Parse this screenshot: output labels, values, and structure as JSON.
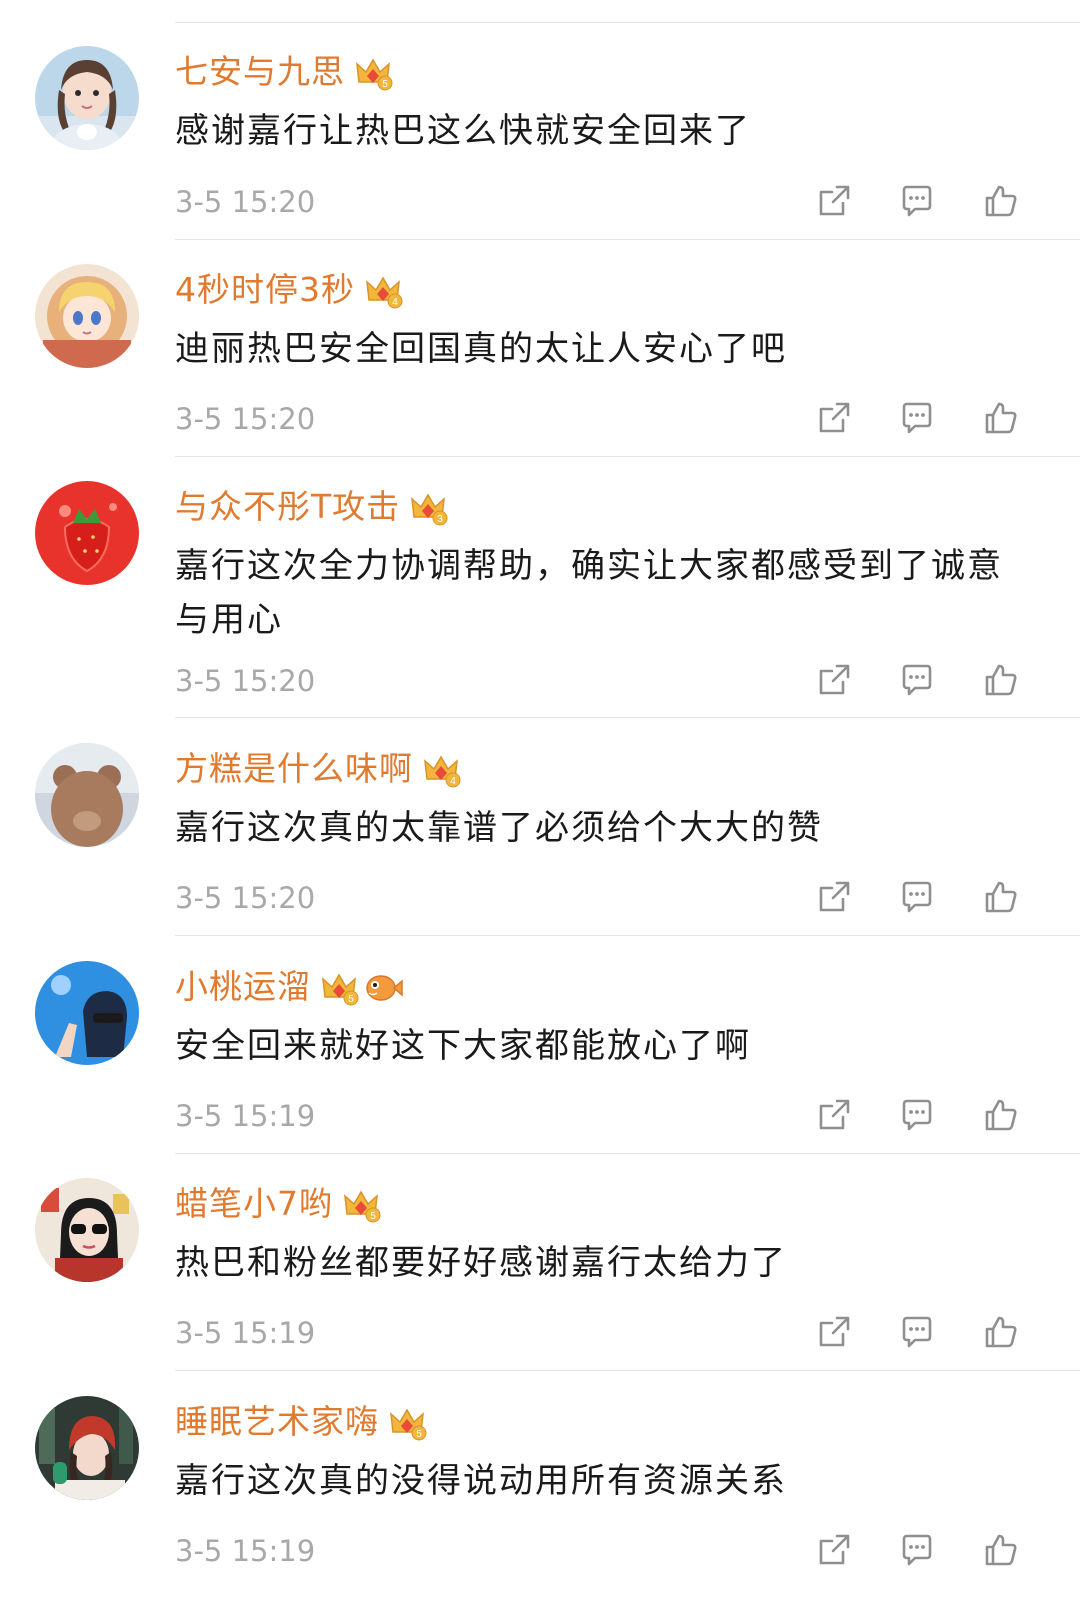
{
  "colors": {
    "username": "#e07a2f",
    "text": "#1a1a1a",
    "timestamp": "#a8a8a8",
    "icon": "#8f8f8f",
    "badge_gold": "#f3b63c",
    "badge_red": "#e94a3a",
    "divider": "#e6e6e6"
  },
  "comments": [
    {
      "username": "七安与九思",
      "badge_level": "5",
      "text": "感谢嘉行让热巴这么快就安全回来了",
      "time": "3-5 15:20",
      "avatar_icon": "girl-braids-avatar"
    },
    {
      "username": "4秒时停3秒",
      "badge_level": "4",
      "text": "迪丽热巴安全回国真的太让人安心了吧",
      "time": "3-5 15:20",
      "avatar_icon": "anime-blonde-avatar"
    },
    {
      "username": "与众不彤T攻击",
      "badge_level": "3",
      "text": "嘉行这次全力协调帮助，确实让大家都感受到了诚意与用心",
      "time": "3-5 15:20",
      "avatar_icon": "strawberry-avatar"
    },
    {
      "username": "方糕是什么味啊",
      "badge_level": "4",
      "text": "嘉行这次真的太靠谱了必须给个大大的赞",
      "time": "3-5 15:20",
      "avatar_icon": "bear-avatar"
    },
    {
      "username": "小桃运溜",
      "badge_level": "5",
      "extra_badge": "pufferfish-icon",
      "text": "安全回来就好这下大家都能放心了啊",
      "time": "3-5 15:19",
      "avatar_icon": "girl-blue-sky-avatar"
    },
    {
      "username": "蜡笔小7哟",
      "badge_level": "5",
      "text": "热巴和粉丝都要好好感谢嘉行太给力了",
      "time": "3-5 15:19",
      "avatar_icon": "girl-sunglasses-avatar"
    },
    {
      "username": "睡眠艺术家嗨",
      "badge_level": "5",
      "text": "嘉行这次真的没得说动用所有资源关系",
      "time": "3-5 15:19",
      "avatar_icon": "girl-red-hat-avatar"
    }
  ]
}
